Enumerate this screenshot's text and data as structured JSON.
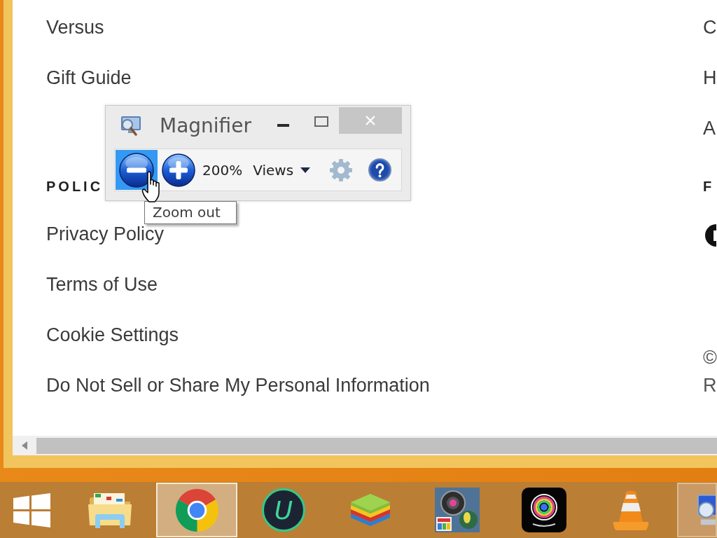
{
  "web_page": {
    "footer": {
      "columns": [
        {
          "groups": [
            {
              "kind": "links",
              "links": [
                "Versus",
                "Gift Guide"
              ]
            },
            {
              "kind": "links",
              "heading": "POLIC",
              "links": [
                "Privacy Policy",
                "Terms of Use",
                "Cookie Settings",
                "Do Not Sell or Share My Personal Information"
              ]
            }
          ]
        },
        {
          "groups": [
            {
              "kind": "links",
              "links": [
                "C",
                "H",
                "A"
              ]
            },
            {
              "kind": "social",
              "heading": "F"
            },
            {
              "kind": "copyright",
              "lines": [
                "©",
                "R"
              ]
            }
          ]
        }
      ]
    }
  },
  "magnifier": {
    "title": "Magnifier",
    "toolbar": {
      "zoom_buttons": [
        {
          "kind": "zoom_out",
          "highlighted": true
        },
        {
          "kind": "zoom_in",
          "highlighted": false
        }
      ],
      "zoom_level": "200%",
      "tools": [
        {
          "kind": "views",
          "text": "Views",
          "highlighted": false
        },
        {
          "kind": "settings",
          "highlighted": false
        },
        {
          "kind": "help",
          "highlighted": false
        }
      ]
    },
    "tooltip": "Zoom out"
  },
  "taskbar": {
    "items": [
      {
        "kind": "start",
        "open": false,
        "selected": false
      },
      {
        "kind": "folder",
        "open": false,
        "selected": false
      },
      {
        "kind": "browser",
        "open": true,
        "selected": true
      },
      {
        "kind": "letter_logo",
        "text": "U",
        "open": false,
        "selected": false
      },
      {
        "kind": "stack",
        "open": false,
        "selected": false
      },
      {
        "kind": "camera_photo",
        "open": false,
        "selected": false
      },
      {
        "kind": "webcam",
        "open": false,
        "selected": false
      },
      {
        "kind": "cone",
        "open": false,
        "selected": false
      },
      {
        "kind": "magnifier",
        "open": true,
        "selected": false
      }
    ]
  }
}
